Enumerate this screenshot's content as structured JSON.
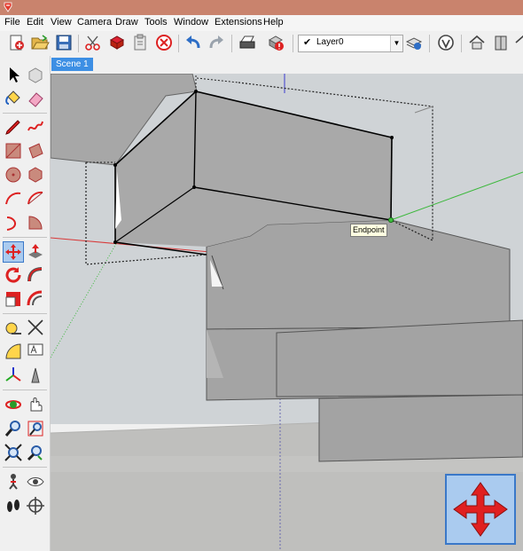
{
  "menubar": {
    "items": [
      "File",
      "Edit",
      "View",
      "Camera",
      "Draw",
      "Tools",
      "Window",
      "Extensions",
      "Help"
    ]
  },
  "toolbar": {
    "layer_check": "✔",
    "layer_name": "Layer0",
    "layer_arrow": "▼"
  },
  "scene": {
    "tab_label": "Scene 1"
  },
  "viewport": {
    "tooltip": "Endpoint"
  },
  "colors": {
    "title_bar": "#c9836d",
    "scene_tab": "#3d8fe4",
    "sky": "#cfd3d6",
    "ground": "#bfbfbd",
    "box_face": "#a4a4a4",
    "red_axis": "#d83a3a",
    "green_axis": "#3cb83c",
    "blue_axis": "#3b3bd0"
  },
  "icons": {
    "toolbar": [
      "new-model-icon",
      "open-icon",
      "save-icon",
      "cut-icon",
      "copy-icon",
      "paste-icon",
      "erase-icon",
      "undo-icon",
      "redo-icon",
      "print-icon",
      "model-info-icon",
      "layer-manager-icon",
      "extension-warehouse-icon",
      "3d-warehouse-icon",
      "component-icon",
      "house-icon"
    ],
    "left": [
      "select-icon",
      "make-component-icon",
      "paint-bucket-icon",
      "eraser-icon",
      "pencil-icon",
      "freehand-icon",
      "rectangle-icon",
      "rotated-rectangle-icon",
      "circle-icon",
      "polygon-icon",
      "arc-icon",
      "two-point-arc-icon",
      "three-point-arc-icon",
      "pie-icon",
      "move-icon",
      "push-pull-icon",
      "rotate-icon",
      "follow-me-icon",
      "scale-icon",
      "offset-icon",
      "tape-measure-icon",
      "dimension-icon",
      "protractor-icon",
      "text-icon",
      "axes-icon",
      "3d-text-icon",
      "orbit-icon",
      "pan-icon",
      "zoom-icon",
      "zoom-window-icon",
      "zoom-extents-icon",
      "previous-view-icon",
      "position-camera-icon",
      "look-around-icon",
      "walk-icon",
      "section-plane-icon"
    ]
  }
}
